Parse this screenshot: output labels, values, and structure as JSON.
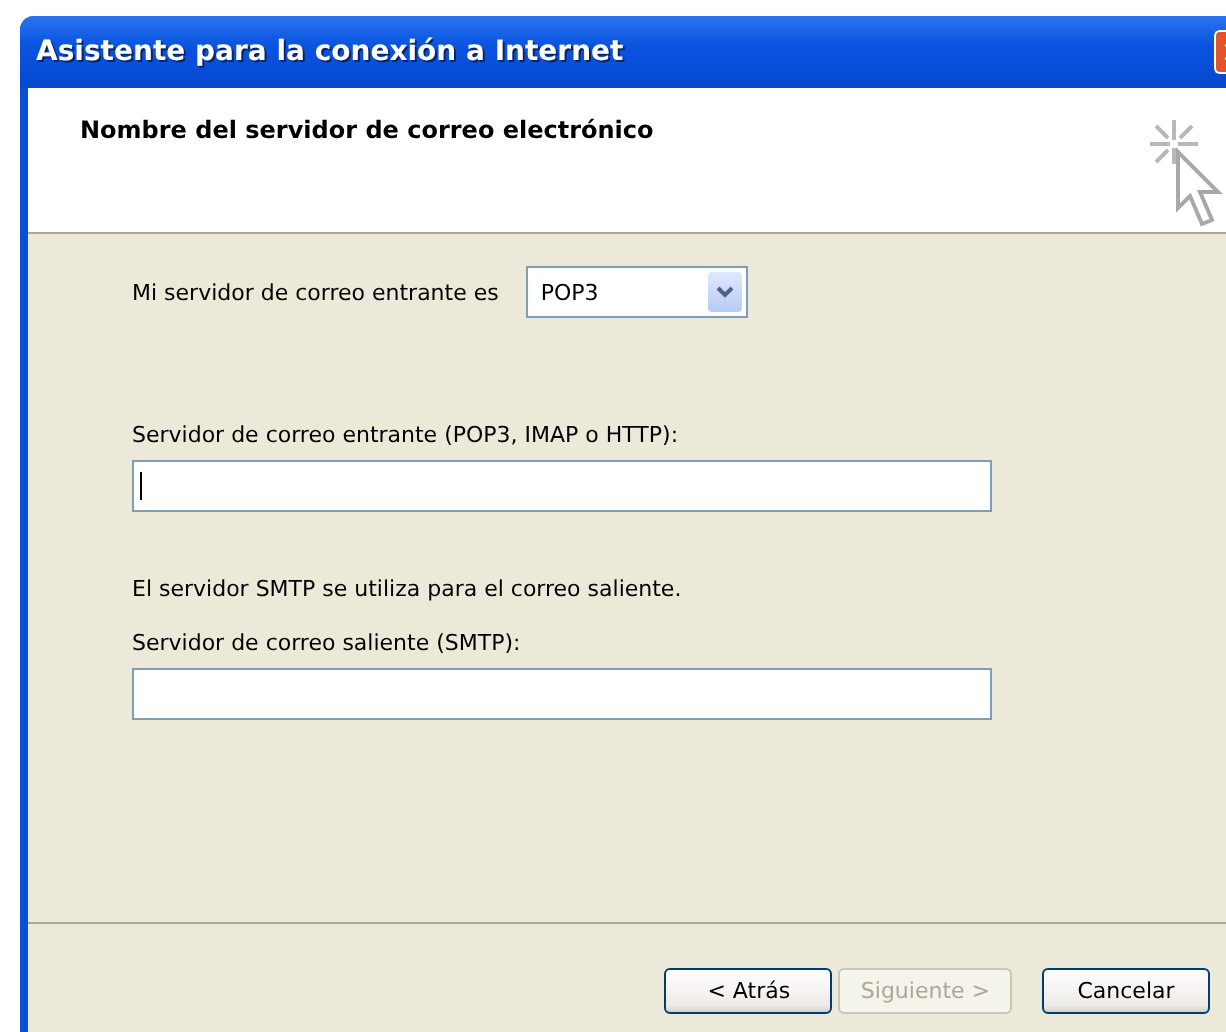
{
  "window": {
    "title": "Asistente para la conexión a Internet"
  },
  "header": {
    "title": "Nombre del servidor de correo electrónico"
  },
  "server_type": {
    "label": "Mi servidor de correo entrante es",
    "value": "POP3"
  },
  "items": [
    {
      "kind": "field",
      "label": "Servidor de correo entrante (POP3, IMAP o HTTP):",
      "focused": true
    },
    {
      "kind": "note",
      "text": "El servidor SMTP se utiliza para el correo saliente."
    },
    {
      "kind": "field",
      "label": "Servidor de correo saliente (SMTP):",
      "focused": false
    }
  ],
  "buttons": [
    {
      "label": "< Atrás",
      "disabled": false
    },
    {
      "label": "Siguiente >",
      "disabled": true
    },
    {
      "label": "Cancelar",
      "disabled": false
    }
  ]
}
